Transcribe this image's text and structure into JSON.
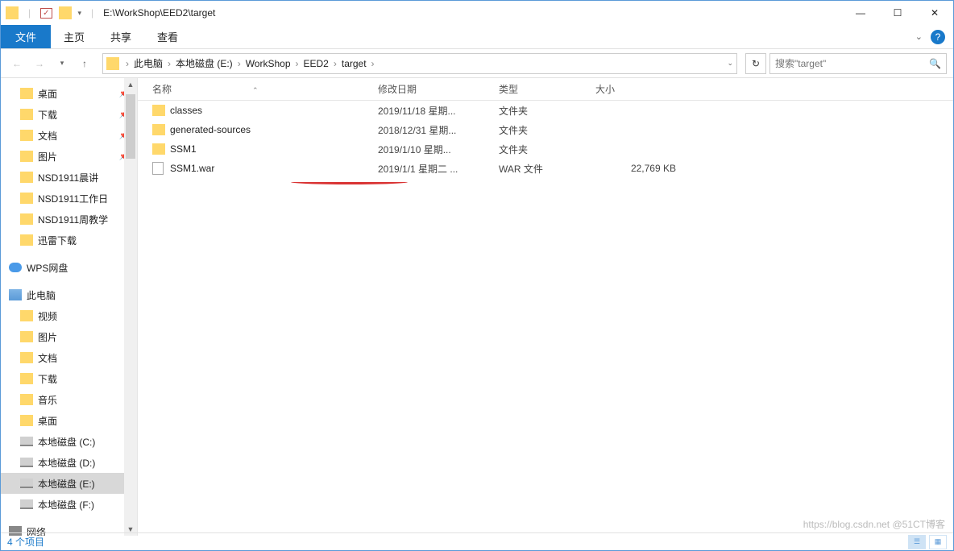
{
  "titlebar": {
    "path": "E:\\WorkShop\\EED2\\target"
  },
  "ribbon": {
    "file_tab": "文件",
    "tabs": [
      "主页",
      "共享",
      "查看"
    ]
  },
  "breadcrumb": {
    "items": [
      "此电脑",
      "本地磁盘 (E:)",
      "WorkShop",
      "EED2",
      "target"
    ]
  },
  "search": {
    "placeholder": "搜索\"target\""
  },
  "sidebar": {
    "quick_access": [
      {
        "label": "桌面",
        "pinned": true,
        "icon": "folder"
      },
      {
        "label": "下载",
        "pinned": true,
        "icon": "folder"
      },
      {
        "label": "文档",
        "pinned": true,
        "icon": "folder"
      },
      {
        "label": "图片",
        "pinned": true,
        "icon": "folder"
      },
      {
        "label": "NSD1911晨讲",
        "pinned": false,
        "icon": "folder"
      },
      {
        "label": "NSD1911工作日",
        "pinned": false,
        "icon": "folder"
      },
      {
        "label": "NSD1911周教学",
        "pinned": false,
        "icon": "folder"
      },
      {
        "label": "迅雷下载",
        "pinned": false,
        "icon": "folder"
      }
    ],
    "wps": "WPS网盘",
    "this_pc": "此电脑",
    "pc_items": [
      {
        "label": "视频",
        "icon": "folder"
      },
      {
        "label": "图片",
        "icon": "folder"
      },
      {
        "label": "文档",
        "icon": "folder"
      },
      {
        "label": "下载",
        "icon": "folder"
      },
      {
        "label": "音乐",
        "icon": "folder"
      },
      {
        "label": "桌面",
        "icon": "folder"
      },
      {
        "label": "本地磁盘 (C:)",
        "icon": "drive"
      },
      {
        "label": "本地磁盘 (D:)",
        "icon": "drive"
      },
      {
        "label": "本地磁盘 (E:)",
        "icon": "drive",
        "selected": true
      },
      {
        "label": "本地磁盘 (F:)",
        "icon": "drive"
      }
    ],
    "network": "网络"
  },
  "columns": {
    "name": "名称",
    "date": "修改日期",
    "type": "类型",
    "size": "大小"
  },
  "files": [
    {
      "name": "classes",
      "date": "2019/11/18 星期...",
      "type": "文件夹",
      "size": "",
      "icon": "folder"
    },
    {
      "name": "generated-sources",
      "date": "2018/12/31 星期...",
      "type": "文件夹",
      "size": "",
      "icon": "folder"
    },
    {
      "name": "SSM1",
      "date": "2019/1/10 星期...",
      "type": "文件夹",
      "size": "",
      "icon": "folder"
    },
    {
      "name": "SSM1.war",
      "date": "2019/1/1 星期二 ...",
      "type": "WAR 文件",
      "size": "22,769 KB",
      "icon": "file"
    }
  ],
  "statusbar": {
    "item_count": "4 个项目"
  },
  "watermark": "https://blog.csdn.net @51CT博客"
}
